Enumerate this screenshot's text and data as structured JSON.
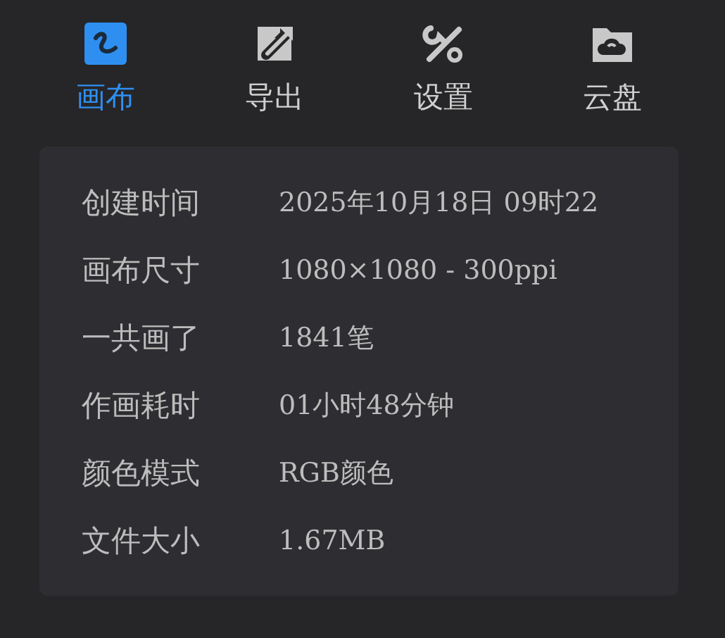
{
  "tabs": [
    {
      "label": "画布",
      "kind": "canvas",
      "selected": true
    },
    {
      "label": "导出",
      "kind": "export",
      "selected": false
    },
    {
      "label": "设置",
      "kind": "settings",
      "selected": false
    },
    {
      "label": "云盘",
      "kind": "cloud",
      "selected": false
    }
  ],
  "info": [
    {
      "label": "创建时间",
      "value": "2025年10月18日 09时22"
    },
    {
      "label": "画布尺寸",
      "value": "1080×1080 - 300ppi"
    },
    {
      "label": "一共画了",
      "value": "1841笔"
    },
    {
      "label": "作画耗时",
      "value": "01小时48分钟"
    },
    {
      "label": "颜色模式",
      "value": "RGB颜色"
    },
    {
      "label": "文件大小",
      "value": "1.67MB"
    }
  ]
}
